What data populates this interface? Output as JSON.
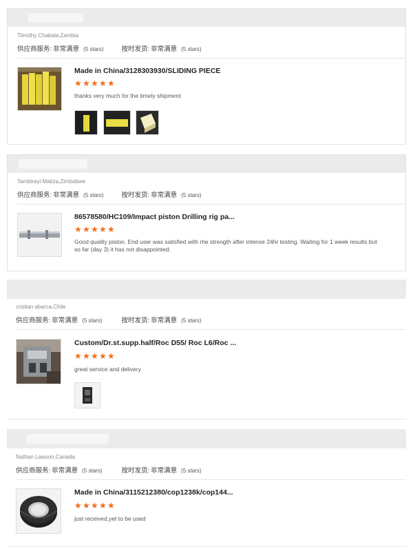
{
  "colors": {
    "accent": "#f26a1b",
    "band": "#ebebeb",
    "border": "#e2e2e2"
  },
  "labels": {
    "supplier_service": "供应商服务:",
    "on_time_delivery": "按时发货:"
  },
  "reviews": [
    {
      "reviewer": "Timothy Chabala,Zambia",
      "supplier_rating": "非常满意",
      "supplier_stars": "(5 stars)",
      "delivery_rating": "非常满意",
      "delivery_stars": "(5 stars)",
      "product_title": "Made in China/3128303930/SLIDING PIECE",
      "stars": 5,
      "comment": "thanks very much for the timely shipment",
      "thumb_icon": "yellow-sliding-piece-image",
      "photos": [
        "yellow-part-photo-1",
        "yellow-part-photo-2",
        "yellow-part-photo-3"
      ]
    },
    {
      "reviewer": "Tambirayi Matiza,Zimbabwe",
      "supplier_rating": "非常满意",
      "supplier_stars": "(5 stars)",
      "delivery_rating": "非常满意",
      "delivery_stars": "(5 stars)",
      "product_title": "86578580/HC109/Impact piston Drilling rig pa...",
      "stars": 5,
      "comment": "Good quality piston. End user was satisfied with rhe strength after intense 24hr testing. Waiting for 1 week results but so far (day 3) it has not disappointed.",
      "thumb_icon": "impact-piston-image",
      "photos": []
    },
    {
      "reviewer": "cristian abarca,Chile",
      "supplier_rating": "非常满意",
      "supplier_stars": "(5 stars)",
      "delivery_rating": "非常满意",
      "delivery_stars": "(5 stars)",
      "product_title": "Custom/Dr.st.supp.half/Roc D55/ Roc L6/Roc ...",
      "stars": 5,
      "comment": "great service and delivery",
      "thumb_icon": "support-half-image",
      "photos": [
        "support-half-photo-1"
      ]
    },
    {
      "reviewer": "Nathan Lawson,Canada",
      "supplier_rating": "非常满意",
      "supplier_stars": "(5 stars)",
      "delivery_rating": "非常满意",
      "delivery_stars": "(5 stars)",
      "product_title": "Made in China/3115212380/cop1238k/cop144...",
      "stars": 5,
      "comment": "just received,yet to be used",
      "thumb_icon": "seal-ring-image",
      "photos": []
    }
  ]
}
